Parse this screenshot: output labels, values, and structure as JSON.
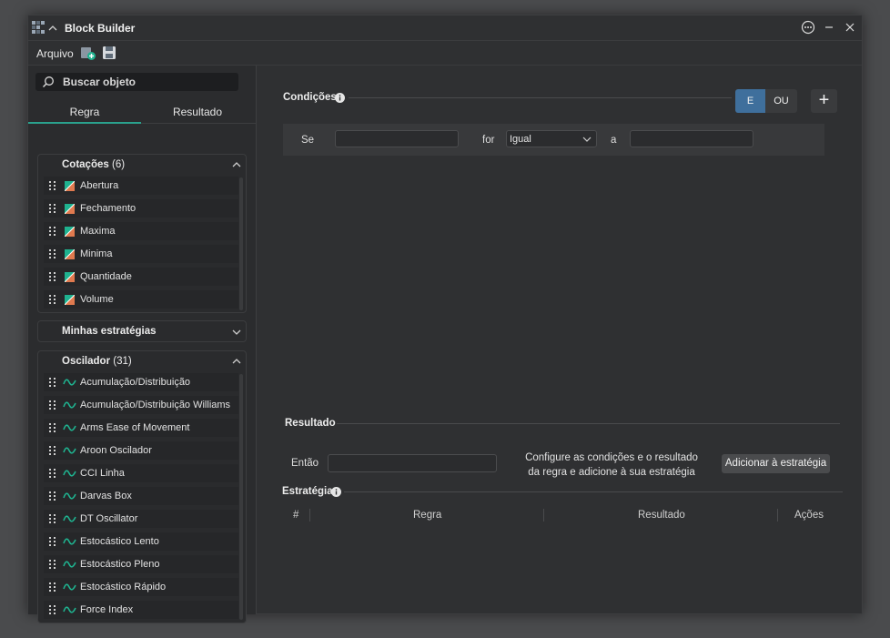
{
  "window": {
    "title": "Block Builder"
  },
  "menu": {
    "arquivo": "Arquivo"
  },
  "sidebar": {
    "search_placeholder": "Buscar objeto",
    "tabs": [
      {
        "label": "Regra",
        "active": true
      },
      {
        "label": "Resultado",
        "active": false
      }
    ],
    "groups": {
      "cotacoes": {
        "title": "Cotações",
        "count": "(6)",
        "items": [
          "Abertura",
          "Fechamento",
          "Maxima",
          "Minima",
          "Quantidade",
          "Volume"
        ]
      },
      "minhas": {
        "title": "Minhas estratégias"
      },
      "oscilador": {
        "title": "Oscilador",
        "count": "(31)",
        "items": [
          "Acumulação/Distribuição",
          "Acumulação/Distribuição Williams",
          "Arms Ease of Movement",
          "Aroon Oscilador",
          "CCI Linha",
          "Darvas Box",
          "DT Oscillator",
          "Estocástico Lento",
          "Estocástico Pleno",
          "Estocástico Rápido",
          "Force Index"
        ]
      }
    }
  },
  "conditions": {
    "label": "Condições",
    "btn_e": "E",
    "btn_ou": "OU",
    "btn_add": "+",
    "row": {
      "se": "Se",
      "for": "for",
      "select_value": "Igual",
      "a": "a"
    }
  },
  "result": {
    "label": "Resultado",
    "entao": "Então",
    "help_line1": "Configure as condições e o resultado",
    "help_line2": "da regra e adicione à sua estratégia",
    "add_button": "Adicionar à estratégia"
  },
  "strategy": {
    "label": "Estratégia",
    "columns": [
      "#",
      "Regra",
      "Resultado",
      "Ações"
    ]
  },
  "colors": {
    "accent": "#2aa18d",
    "selected_button": "#3f6f9c",
    "icon_teal": "#1fb28f",
    "icon_orange": "#e07a4f"
  }
}
